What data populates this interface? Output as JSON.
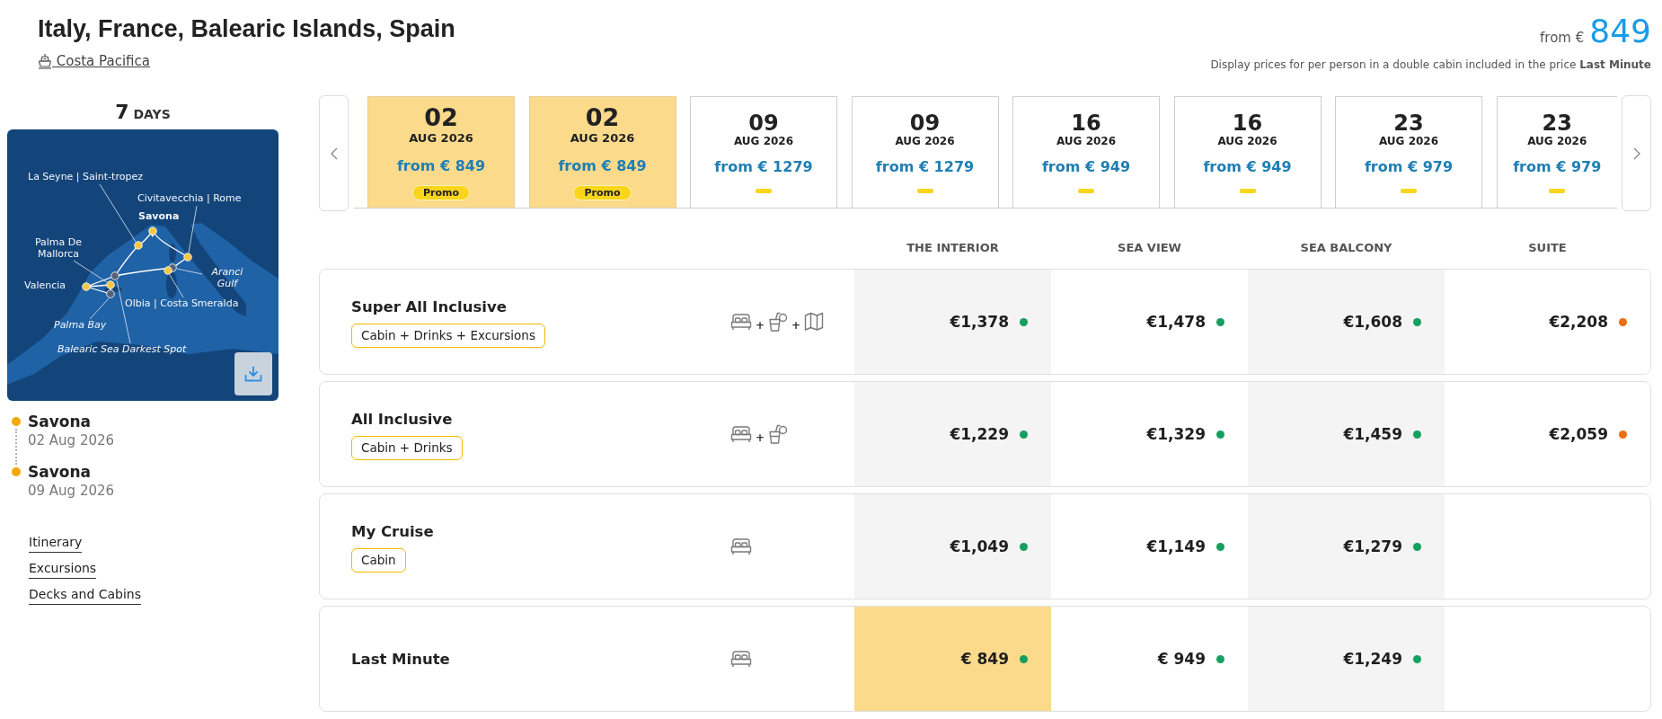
{
  "header": {
    "title": "Italy, France, Balearic Islands, Spain",
    "ship": "Costa Pacifica",
    "price_prefix": "from €",
    "price": "849",
    "note": "Display prices for per person in a double cabin included in the price **Last Minute**"
  },
  "itinerary": {
    "duration": "7",
    "duration_unit": "DAYS",
    "map": {
      "labels": [
        {
          "name": "La Seyne | Saint-tropez",
          "kind": "port"
        },
        {
          "name": "Civitavecchia | Rome",
          "kind": "port"
        },
        {
          "name": "Savona",
          "kind": "home_port"
        },
        {
          "name": "Palma De Mallorca",
          "kind": "port"
        },
        {
          "name": "Valencia",
          "kind": "port"
        },
        {
          "name": "Aranci Gulf",
          "kind": "scenic"
        },
        {
          "name": "Olbia | Costa Smeralda",
          "kind": "port"
        },
        {
          "name": "Palma Bay",
          "kind": "scenic"
        },
        {
          "name": "Balearic Sea Darkest Spot",
          "kind": "scenic"
        }
      ]
    },
    "stops": [
      {
        "port": "Savona",
        "date": "02 Aug 2026"
      },
      {
        "port": "Savona",
        "date": "09 Aug 2026"
      }
    ],
    "links": [
      "Itinerary",
      "Excursions",
      "Decks and Cabins"
    ]
  },
  "departures": [
    {
      "day": "02",
      "month": "AUG 2026",
      "price": "from € 849",
      "badge": "Promo",
      "selected": true
    },
    {
      "day": "02",
      "month": "AUG 2026",
      "price": "from € 849",
      "badge": "Promo",
      "selected": true
    },
    {
      "day": "09",
      "month": "AUG 2026",
      "price": "from € 1279",
      "selected": false
    },
    {
      "day": "09",
      "month": "AUG 2026",
      "price": "from € 1279",
      "selected": false
    },
    {
      "day": "16",
      "month": "AUG 2026",
      "price": "from € 949",
      "selected": false
    },
    {
      "day": "16",
      "month": "AUG 2026",
      "price": "from € 949",
      "selected": false
    },
    {
      "day": "23",
      "month": "AUG 2026",
      "price": "from € 979",
      "selected": false
    },
    {
      "day": "23",
      "month": "AUG 2026",
      "price": "from € 979",
      "selected": false
    }
  ],
  "fares": {
    "columns": [
      "THE INTERIOR",
      "SEA VIEW",
      "SEA BALCONY",
      "SUITE"
    ],
    "rows": [
      {
        "name": "Super All Inclusive",
        "includes": "Cabin + Drinks + Excursions",
        "features": [
          {
            "kind": "bed"
          },
          {
            "joiner": "+",
            "kind": "drinks"
          },
          {
            "joiner": "+",
            "kind": "map"
          }
        ],
        "prices": [
          {
            "amount": "€1,378",
            "color": "#14a05f",
            "selected": false
          },
          {
            "amount": "€1,478",
            "color": "#14a05f",
            "selected": false
          },
          {
            "amount": "€1,608",
            "color": "#14a05f",
            "selected": false
          },
          {
            "amount": "€2,208",
            "color": "#f26b12",
            "selected": false
          }
        ]
      },
      {
        "name": "All Inclusive",
        "includes": "Cabin + Drinks",
        "features": [
          {
            "kind": "bed"
          },
          {
            "joiner": "+",
            "kind": "drinks"
          }
        ],
        "prices": [
          {
            "amount": "€1,229",
            "color": "#14a05f",
            "selected": false
          },
          {
            "amount": "€1,329",
            "color": "#14a05f",
            "selected": false
          },
          {
            "amount": "€1,459",
            "color": "#14a05f",
            "selected": false
          },
          {
            "amount": "€2,059",
            "color": "#f26b12",
            "selected": false
          }
        ]
      },
      {
        "name": "My Cruise",
        "includes": "Cabin",
        "features": [
          {
            "kind": "bed"
          }
        ],
        "prices": [
          {
            "amount": "€1,049",
            "color": "#14a05f",
            "selected": false
          },
          {
            "amount": "€1,149",
            "color": "#14a05f",
            "selected": false
          },
          {
            "amount": "€1,279",
            "color": "#14a05f",
            "selected": false
          }
        ]
      },
      {
        "name": "Last Minute",
        "features": [
          {
            "kind": "bed"
          }
        ],
        "prices": [
          {
            "amount": "€ 849",
            "color": "#14a05f",
            "selected": true
          },
          {
            "amount": "€ 949",
            "color": "#14a05f",
            "selected": false
          },
          {
            "amount": "€1,249",
            "color": "#14a05f",
            "selected": false
          }
        ]
      }
    ]
  }
}
